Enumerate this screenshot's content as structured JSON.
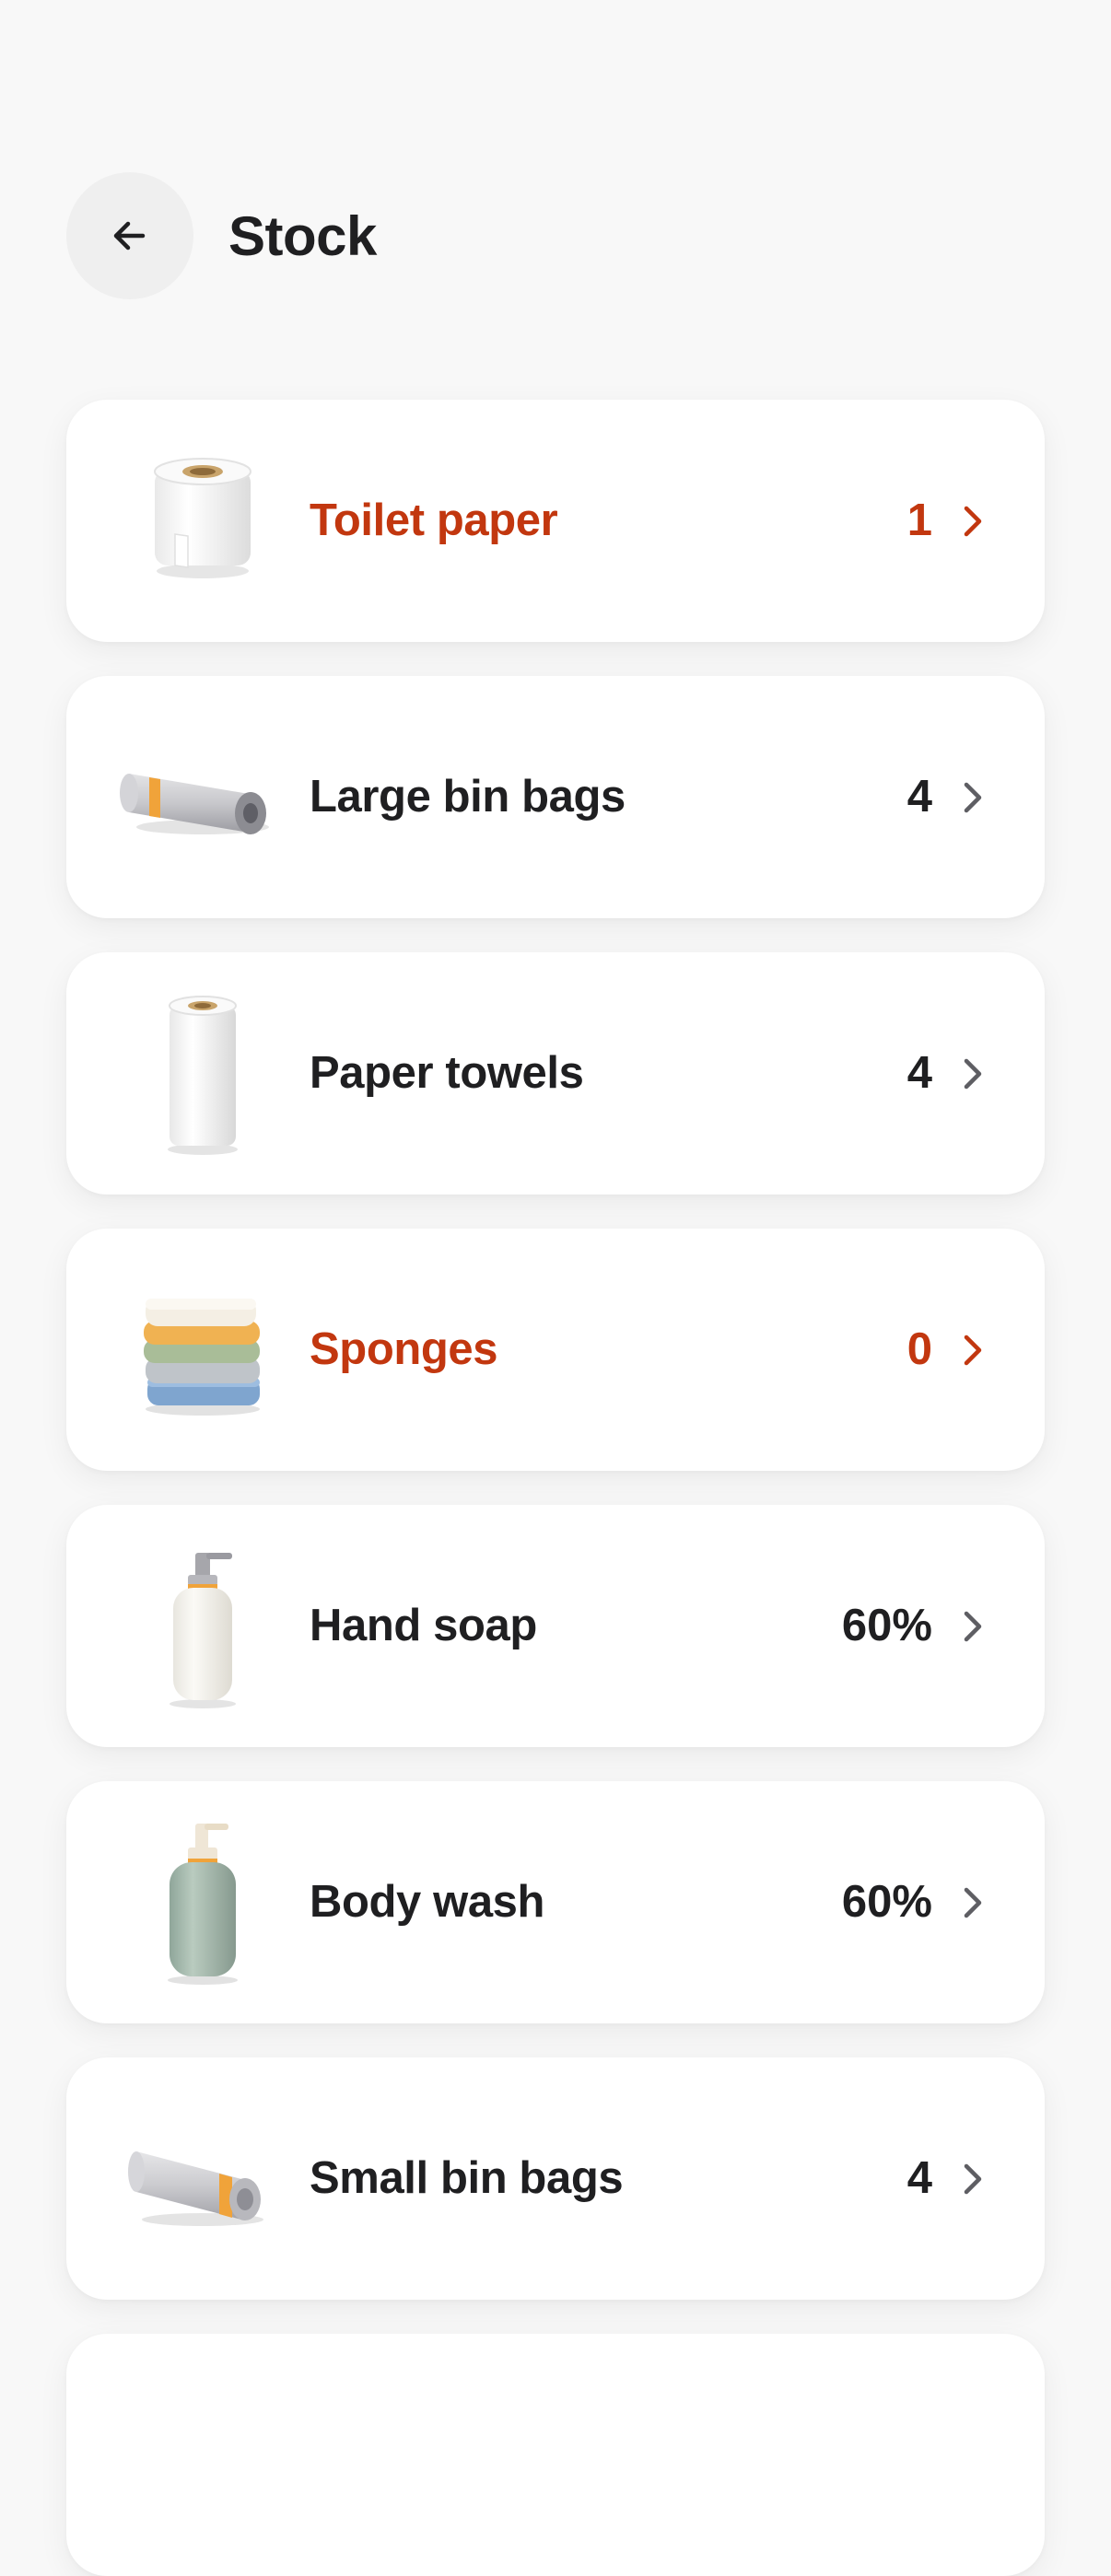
{
  "header": {
    "title": "Stock",
    "back_icon": "arrow-left-icon"
  },
  "colors": {
    "low_stock": "#c2370f",
    "text": "#1f1f21",
    "background": "#f8f8f8",
    "card": "#ffffff"
  },
  "items": [
    {
      "name": "Toilet paper",
      "count": "1",
      "status": "low",
      "icon": "toilet-paper-icon"
    },
    {
      "name": "Large bin bags",
      "count": "4",
      "status": "ok",
      "icon": "bin-bag-roll-icon"
    },
    {
      "name": "Paper towels",
      "count": "4",
      "status": "ok",
      "icon": "paper-towel-icon"
    },
    {
      "name": "Sponges",
      "count": "0",
      "status": "low",
      "icon": "sponges-icon"
    },
    {
      "name": "Hand soap",
      "count": "60%",
      "status": "ok",
      "icon": "soap-dispenser-icon"
    },
    {
      "name": "Body wash",
      "count": "60%",
      "status": "ok",
      "icon": "body-wash-bottle-icon"
    },
    {
      "name": "Small bin bags",
      "count": "4",
      "status": "ok",
      "icon": "bin-bag-roll-icon"
    }
  ]
}
